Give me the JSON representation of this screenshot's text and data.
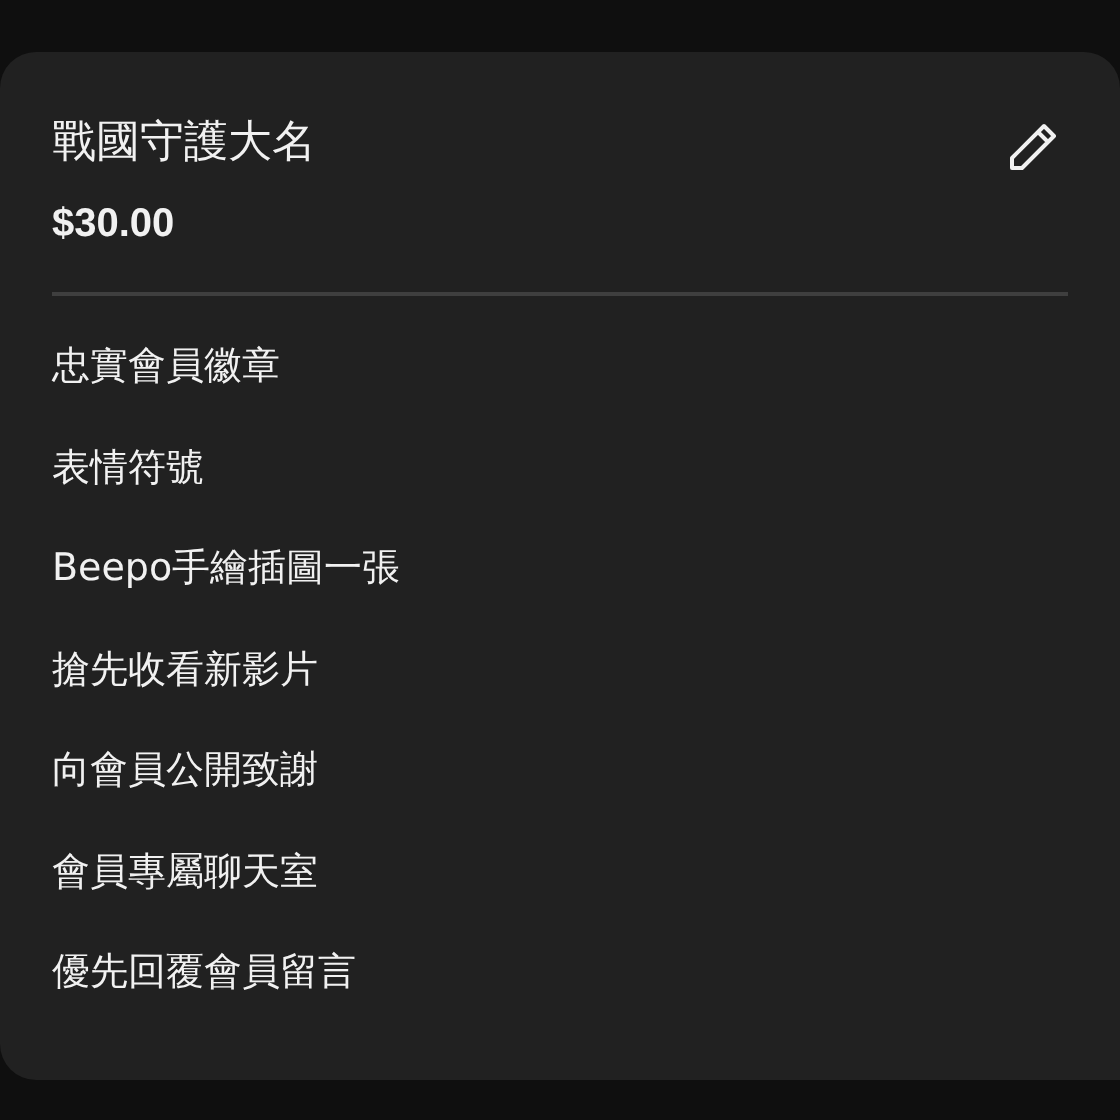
{
  "tier": {
    "name": "戰國守護大名",
    "price": "$30.00"
  },
  "perks": [
    "忠實會員徽章",
    "表情符號",
    "Beepo手繪插圖一張",
    "搶先收看新影片",
    "向會員公開致謝",
    "會員專屬聊天室",
    "優先回覆會員留言"
  ]
}
